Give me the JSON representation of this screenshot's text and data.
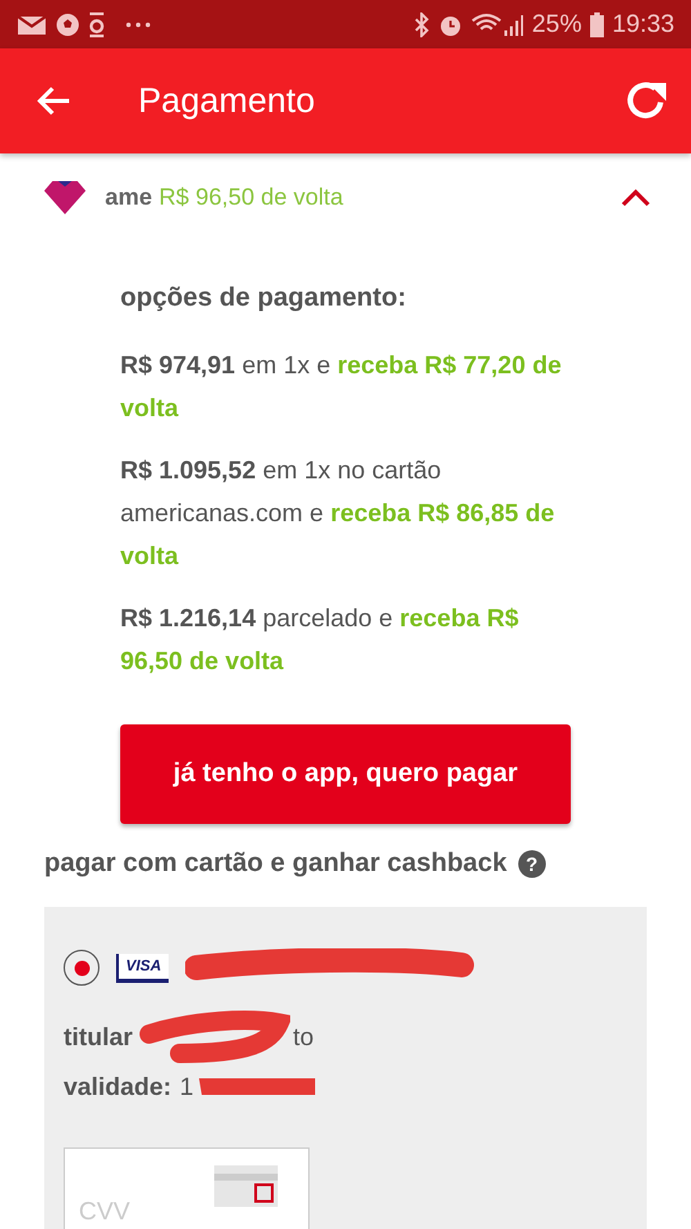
{
  "status_bar": {
    "battery": "25%",
    "time": "19:33"
  },
  "app_bar": {
    "title": "Pagamento"
  },
  "ame": {
    "brand": "ame",
    "cashback": "R$ 96,50 de volta",
    "expanded": true
  },
  "options_title": "opções de pagamento:",
  "options": [
    {
      "price": "R$ 974,91",
      "terms": "em 1x e",
      "cashback": "receba R$ 77,20 de volta"
    },
    {
      "price": "R$ 1.095,52",
      "terms": "em 1x no cartão americanas.com e",
      "cashback": "receba R$ 86,85 de volta"
    },
    {
      "price": "R$ 1.216,14",
      "terms": "parcelado e",
      "cashback": "receba R$ 96,50 de volta"
    }
  ],
  "pay_button": "já tenho o app, quero pagar",
  "card_section": {
    "title": "pagar com cartão e ganhar cashback",
    "help": "?"
  },
  "card": {
    "selected": true,
    "brand": "VISA",
    "holder_label": "titular",
    "holder_value": "to",
    "expiry_label": "validade:",
    "expiry_value": "1"
  },
  "cvv": {
    "placeholder": "CVV"
  }
}
